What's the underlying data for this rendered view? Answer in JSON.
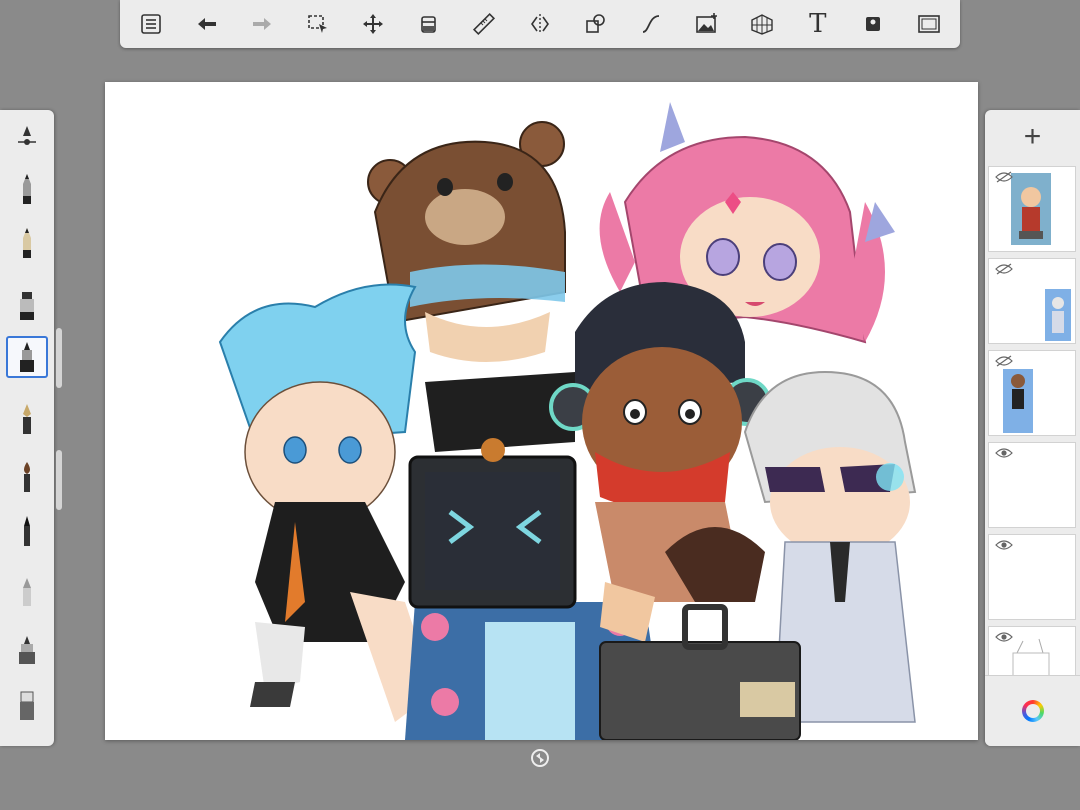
{
  "toolbar": {
    "items": [
      {
        "name": "menu-list-icon"
      },
      {
        "name": "undo-icon"
      },
      {
        "name": "redo-icon"
      },
      {
        "name": "selection-icon"
      },
      {
        "name": "transform-move-icon"
      },
      {
        "name": "fill-bucket-icon"
      },
      {
        "name": "ruler-icon"
      },
      {
        "name": "symmetry-icon"
      },
      {
        "name": "shapes-icon"
      },
      {
        "name": "curve-icon"
      },
      {
        "name": "add-image-icon"
      },
      {
        "name": "perspective-grid-icon"
      },
      {
        "name": "text-tool-icon",
        "glyph": "T"
      },
      {
        "name": "stencil-icon"
      },
      {
        "name": "fullscreen-icon"
      }
    ]
  },
  "brushes": [
    {
      "name": "brush-settings-icon"
    },
    {
      "name": "pencil-brush-icon"
    },
    {
      "name": "graphite-pencil-icon"
    },
    {
      "name": "marker-brush-icon"
    },
    {
      "name": "inking-pen-icon",
      "selected": true
    },
    {
      "name": "fountain-pen-icon"
    },
    {
      "name": "paint-brush-icon"
    },
    {
      "name": "calligraphy-brush-icon"
    },
    {
      "name": "airbrush-icon"
    },
    {
      "name": "fill-pen-icon"
    },
    {
      "name": "eraser-brush-icon"
    }
  ],
  "layers": {
    "add_label": "+",
    "items": [
      {
        "name": "layer-1",
        "visibility": "hidden"
      },
      {
        "name": "layer-2",
        "visibility": "hidden"
      },
      {
        "name": "layer-3",
        "visibility": "hidden"
      },
      {
        "name": "layer-4",
        "visibility": "visible"
      },
      {
        "name": "layer-5",
        "visibility": "visible"
      },
      {
        "name": "layer-6",
        "visibility": "visible"
      }
    ]
  },
  "colors": {
    "accent": "#3a78d8",
    "chrome": "#ececec",
    "background": "#8a8a8a"
  }
}
